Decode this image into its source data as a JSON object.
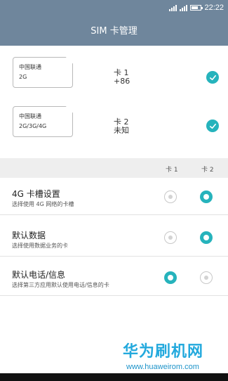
{
  "status_bar": {
    "time": "22:22"
  },
  "title": "SIM 卡管理",
  "sim_cards": [
    {
      "operator": "中国联通",
      "network": "2G",
      "slot_name": "卡 1",
      "number": "+86",
      "selected": true
    },
    {
      "operator": "中国联通",
      "network": "2G/3G/4G",
      "slot_name": "卡 2",
      "number": "未知",
      "selected": true
    }
  ],
  "columns": {
    "card1": "卡 1",
    "card2": "卡 2"
  },
  "settings": [
    {
      "title": "4G 卡槽设置",
      "subtitle": "选择使用 4G 网络的卡槽",
      "selected": "card2"
    },
    {
      "title": "默认数据",
      "subtitle": "选择使用数据业务的卡",
      "selected": "card2"
    },
    {
      "title": "默认电话/信息",
      "subtitle": "选择第三方应用默认使用电话/信息的卡",
      "selected": "card1"
    }
  ],
  "watermark": {
    "brand": "华为刷机网",
    "url": "www.huaweirom.com"
  },
  "colors": {
    "header": "#6f869c",
    "accent": "#26b3bc"
  }
}
